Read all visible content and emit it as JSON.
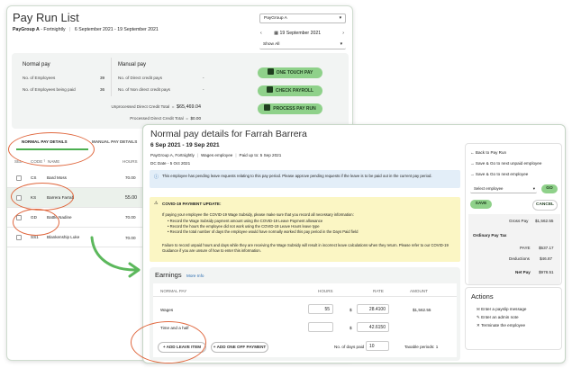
{
  "payrun": {
    "title": "Pay Run List",
    "group": "PayGroup A",
    "frequency": "Fortnightly",
    "dates": "6 September 2021 - 19 September 2021",
    "paygroup_select": "PayGroup A",
    "date_select": "19 September 2021",
    "show_select": "Show All",
    "normal_title": "Normal pay",
    "manual_title": "Manual pay",
    "normal_rows": [
      {
        "label": "No. of Employees",
        "value": "39"
      },
      {
        "label": "No. of Employees being paid",
        "value": "36"
      }
    ],
    "manual_rows": [
      {
        "label": "No. of Direct credit pays",
        "value": "-"
      },
      {
        "label": "No. of Non direct credit pays",
        "value": "-"
      }
    ],
    "unprocessed_label": "Unprocessed Direct Credit Total",
    "unprocessed_value": "$65,469.04",
    "processed_label": "Processed Direct Credit Total",
    "processed_value": "$0.00",
    "btn_one_touch": "ONE TOUCH PAY",
    "btn_check": "CHECK PAYROLL",
    "btn_process": "PROCESS PAY RUN",
    "tab_normal": "NORMAL PAY DETAILS",
    "tab_manual": "MANUAL PAY DETAILS",
    "col_sel": "SEL",
    "col_code": "CODE",
    "col_name": "NAME",
    "col_hours": "HOURS",
    "employees": [
      {
        "code": "CS",
        "name": "Bard Moss",
        "hours": "70.00"
      },
      {
        "code": "KS",
        "name": "Barrera Farrah",
        "hours": "55.00"
      },
      {
        "code": "GD",
        "name": "Battle Nadine",
        "hours": "70.00"
      },
      {
        "code": "SS1",
        "name": "Blankenship Luke",
        "hours": "70.00"
      }
    ]
  },
  "detail": {
    "title": "Normal pay details for Farrah Barrera",
    "period": "6 Sep 2021 - 19 Sep 2021",
    "group": "PayGroup A, Fortnightly",
    "emp_type": "Wages employee",
    "paid_up_to": "Paid up to: 5 Sep 2021",
    "dc_date": "DC Date - 5 Oct 2021",
    "info_notice": "This employee has pending leave requests relating to this pay period. Please approve pending requests if the leave is to be paid out in the current pay period.",
    "covid_title": "COVID-19 PAYMENT UPDATE:",
    "covid_intro": "If paying your employee the COVID-19 Wage Subsidy, please make sure that you record all necessary information:",
    "covid_points": [
      "Record the Wage Subsidy payment amount using the COVID-19 Leave Payment allowance",
      "Record the hours the employee did not work using the COVID-19 Leave Hours leave type",
      "Record the total number of days the employee would have normally worked this pay period in the Days Paid field"
    ],
    "covid_footer": "Failure to record unpaid hours and days while they are receiving the Wage Subsidy will result in incorrect leave calculations when they return. Please refer to our COVID-19 Guidance if you are unsure of how to enter this information.",
    "earnings_title": "Earnings",
    "more_info": "More Info",
    "col_normal_pay": "NORMAL PAY",
    "col_hours": "HOURS",
    "col_rate": "RATE",
    "col_amount": "AMOUNT",
    "earnings": [
      {
        "name": "Wages",
        "hours": "55",
        "currency": "$",
        "rate": "28.4100",
        "amount": "$1,562.55"
      },
      {
        "name": "Time and a half",
        "hours": "",
        "currency": "$",
        "rate": "42.6150",
        "amount": ""
      }
    ],
    "btn_add_leave": "+ ADD LEAVE ITEM",
    "btn_add_oneoff": "+ ADD ONE OFF PAYMENT",
    "days_paid_label": "No. of days paid",
    "days_paid": "10",
    "taxable_periods": "Taxable periods: 1",
    "nav_back": "Back to Pay Run",
    "nav_save_unpaid": "Save & Go to next unpaid employee",
    "nav_save_next": "Save & Go to next employee",
    "select_employee": "Select employee",
    "btn_go": "GO",
    "btn_save": "SAVE",
    "btn_cancel": "CANCEL",
    "gross_label": "Gross Pay",
    "gross_value": "$1,562.55",
    "tax_title": "Ordinary Pay Tax",
    "paye_label": "PAYE",
    "paye_value": "$537.17",
    "deductions_label": "Deductions",
    "deductions_value": "$46.87",
    "net_label": "Net Pay",
    "net_value": "$978.51",
    "actions_title": "Actions",
    "actions": [
      "Enter a payslip message",
      "Enter an admin note",
      "Terminate the employee"
    ]
  },
  "colors": {
    "accent_green": "#8fd18a",
    "annotation": "#e0683f",
    "info_blue": "#e3eef8",
    "warn_yellow": "#fbf6c4"
  }
}
